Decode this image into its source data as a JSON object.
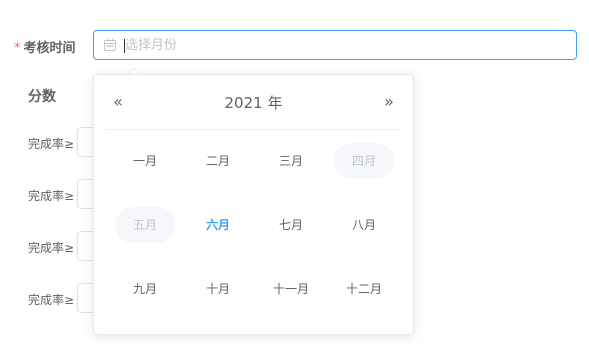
{
  "form": {
    "required_mark": "*",
    "label": "考核时间",
    "date_input": {
      "placeholder": "选择月份",
      "value": ""
    }
  },
  "scores": {
    "title": "分数",
    "rows": [
      {
        "label": "完成率≥"
      },
      {
        "label": "完成率≥"
      },
      {
        "label": "完成率≥"
      },
      {
        "label": "完成率≥"
      }
    ]
  },
  "picker": {
    "prev_year": "«",
    "next_year": "»",
    "year_label": "2021 年",
    "months": [
      {
        "label": "一月",
        "state": "normal"
      },
      {
        "label": "二月",
        "state": "normal"
      },
      {
        "label": "三月",
        "state": "normal"
      },
      {
        "label": "四月",
        "state": "disabled"
      },
      {
        "label": "五月",
        "state": "disabled"
      },
      {
        "label": "六月",
        "state": "current"
      },
      {
        "label": "七月",
        "state": "normal"
      },
      {
        "label": "八月",
        "state": "normal"
      },
      {
        "label": "九月",
        "state": "normal"
      },
      {
        "label": "十月",
        "state": "normal"
      },
      {
        "label": "十一月",
        "state": "normal"
      },
      {
        "label": "十二月",
        "state": "normal"
      }
    ]
  },
  "colors": {
    "accent": "#409eff",
    "required": "#f56c6c",
    "disabled_bg": "#f5f7fa",
    "disabled_text": "#c0c4cc"
  },
  "icons": {
    "date_input": "calendar-icon"
  }
}
